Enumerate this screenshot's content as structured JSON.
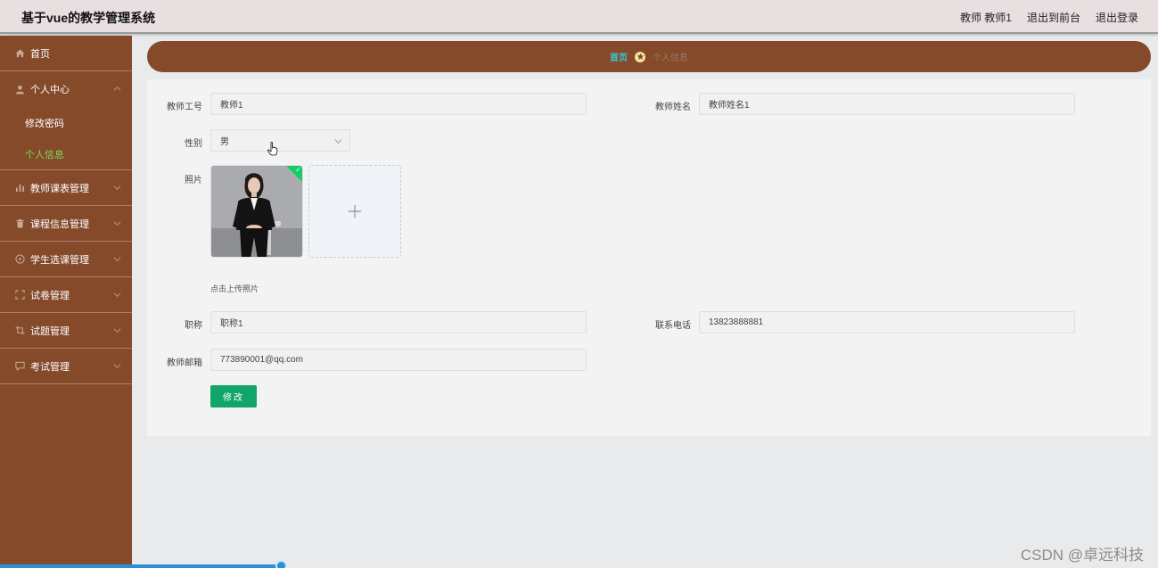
{
  "header": {
    "title": "基于vue的教学管理系统",
    "user_label": "教师 教师1",
    "exit_to_front": "退出到前台",
    "logout": "退出登录"
  },
  "sidebar": {
    "items": [
      {
        "label": "首页",
        "icon": "home-icon"
      },
      {
        "label": "个人中心",
        "icon": "user-icon",
        "sub": [
          {
            "label": "修改密码"
          },
          {
            "label": "个人信息",
            "active": true
          }
        ]
      },
      {
        "label": "教师课表管理",
        "icon": "chart-icon"
      },
      {
        "label": "课程信息管理",
        "icon": "trash-icon"
      },
      {
        "label": "学生选课管理",
        "icon": "compass-icon"
      },
      {
        "label": "试卷管理",
        "icon": "frame-icon"
      },
      {
        "label": "试题管理",
        "icon": "crop-icon"
      },
      {
        "label": "考试管理",
        "icon": "chat-icon"
      }
    ]
  },
  "breadcrumb": {
    "home": "首页",
    "current": "个人信息"
  },
  "form": {
    "teacher_id_label": "教师工号",
    "teacher_id_value": "教师1",
    "teacher_name_label": "教师姓名",
    "teacher_name_value": "教师姓名1",
    "gender_label": "性别",
    "gender_value": "男",
    "photo_label": "照片",
    "upload_hint": "点击上传照片",
    "title_label": "职称",
    "title_value": "职称1",
    "phone_label": "联系电话",
    "phone_value": "13823888881",
    "email_label": "教师邮箱",
    "email_value": "773890001@qq.com",
    "submit_label": "修改"
  },
  "colors": {
    "sidebar_bg": "#844a2a",
    "header_bg": "#e8dfe0",
    "active_menu": "#7ed957",
    "breadcrumb_home": "#3bc6d9",
    "submit_bg": "#12a56a"
  },
  "watermark": "CSDN @卓远科技"
}
